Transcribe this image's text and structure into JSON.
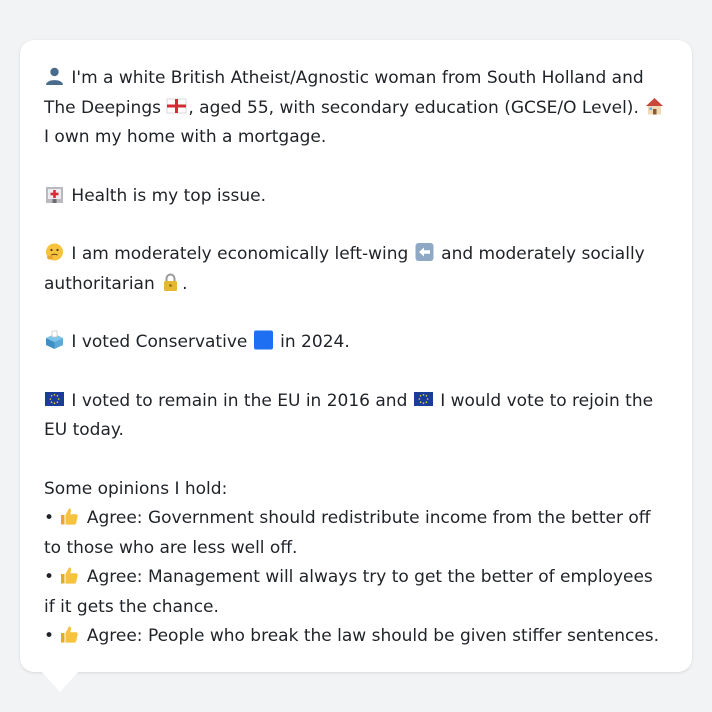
{
  "profile": {
    "p1": {
      "before_flag": "I'm a white British Atheist/Agnostic woman from South Holland and The Deepings",
      "after_flag": ", aged 55, with secondary education (GCSE/O Level).",
      "home": "I own my home with a mortgage."
    },
    "p2": "Health is my top issue.",
    "p3": {
      "a": "I am moderately economically left-wing",
      "b": "and moderately socially authoritarian",
      "c": "."
    },
    "p4": {
      "a": "I voted Conservative",
      "b": "in 2024."
    },
    "p5": {
      "a": "I voted to remain in the EU in 2016 and",
      "b": "I would vote to rejoin the EU today."
    },
    "opinions": {
      "heading": "Some opinions I hold:",
      "items": [
        {
          "bullet": "•",
          "stance": "Agree:",
          "text": "Government should redistribute income from the better off to those who are less well off."
        },
        {
          "bullet": "•",
          "stance": "Agree:",
          "text": "Management will always try to get the better of employees if it gets the chance."
        },
        {
          "bullet": "•",
          "stance": "Agree:",
          "text": "People who break the law should be given stiffer sentences."
        }
      ]
    }
  },
  "icons": [
    "person-icon",
    "england-flag-icon",
    "house-icon",
    "hospital-icon",
    "thinking-face-icon",
    "left-arrow-icon",
    "lock-icon",
    "ballot-box-icon",
    "blue-square-icon",
    "eu-flag-icon",
    "thumbs-up-icon"
  ],
  "colors": {
    "background": "#f2f3f5",
    "bubble": "#ffffff",
    "text": "#1f2328",
    "conservative_blue": "#1e6ff2",
    "eu_blue": "#1a3d99"
  }
}
